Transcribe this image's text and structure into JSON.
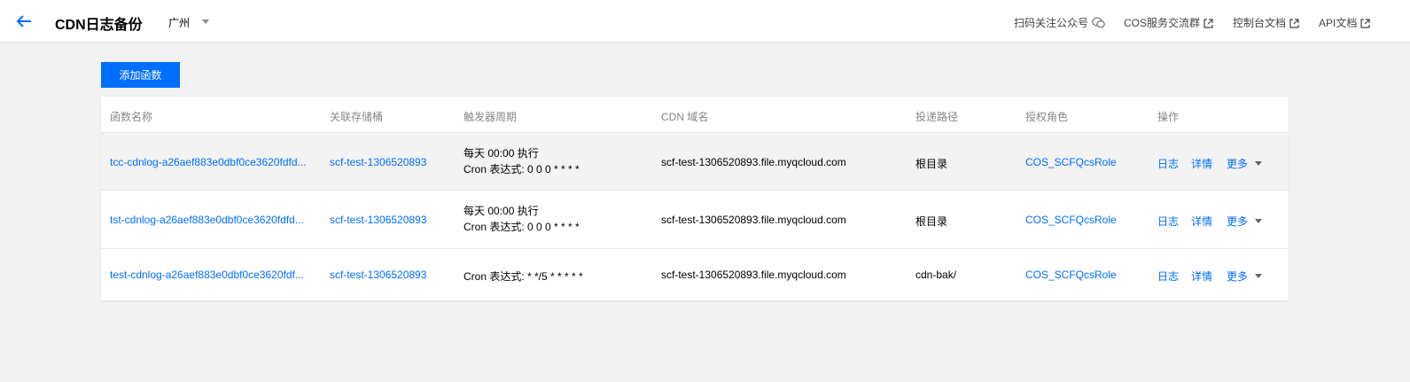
{
  "header": {
    "title": "CDN日志备份",
    "region": "广州",
    "links": {
      "wechat": "扫码关注公众号",
      "cos_group": "COS服务交流群",
      "console_doc": "控制台文档",
      "api_doc": "API文档"
    }
  },
  "toolbar": {
    "add_label": "添加函数"
  },
  "table": {
    "columns": [
      "函数名称",
      "关联存储桶",
      "触发器周期",
      "CDN 域名",
      "投递路径",
      "授权角色",
      "操作"
    ],
    "rows": [
      {
        "name": "tcc-cdnlog-a26aef883e0dbf0ce3620fdfd...",
        "bucket": "scf-test-1306520893",
        "trigger_line1": "每天 00:00 执行",
        "trigger_line2": "Cron 表达式: 0 0 0 * * * *",
        "domain": "scf-test-1306520893.file.myqcloud.com",
        "path": "根目录",
        "role": "COS_SCFQcsRole",
        "action_log": "日志",
        "action_detail": "详情",
        "action_more": "更多"
      },
      {
        "name": "tst-cdnlog-a26aef883e0dbf0ce3620fdfd...",
        "bucket": "scf-test-1306520893",
        "trigger_line1": "每天 00:00 执行",
        "trigger_line2": "Cron 表达式: 0 0 0 * * * *",
        "domain": "scf-test-1306520893.file.myqcloud.com",
        "path": "根目录",
        "role": "COS_SCFQcsRole",
        "action_log": "日志",
        "action_detail": "详情",
        "action_more": "更多"
      },
      {
        "name": "test-cdnlog-a26aef883e0dbf0ce3620fdf...",
        "bucket": "scf-test-1306520893",
        "trigger_line1": "Cron 表达式: * */5 * * * * *",
        "domain": "scf-test-1306520893.file.myqcloud.com",
        "path": "cdn-bak/",
        "role": "COS_SCFQcsRole",
        "action_log": "日志",
        "action_detail": "详情",
        "action_more": "更多"
      }
    ]
  },
  "colors": {
    "accent": "#006eff",
    "page_bg": "#f2f2f2",
    "row_hover": "#f3f3f3"
  },
  "icons": [
    "arrow-left-icon",
    "caret-down-icon",
    "wechat-icon",
    "external-link-icon"
  ]
}
